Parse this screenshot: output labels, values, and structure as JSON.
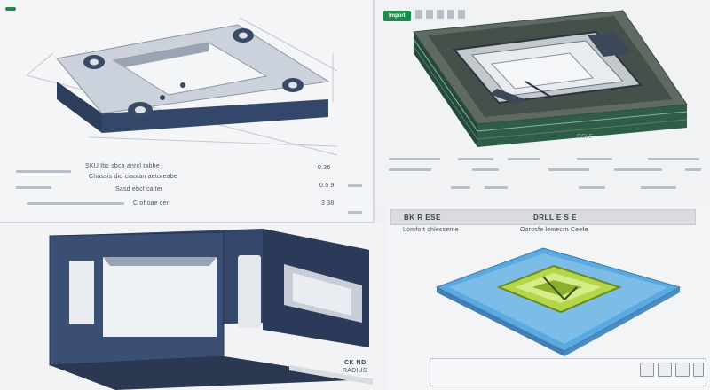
{
  "top_left": {
    "table": {
      "header": "SKU Ibc sbca anrcl tabhe",
      "rows": [
        "Chassis dio ciaotan aetoreabe",
        "Sasd ebct caiter",
        "C ohoae cer"
      ],
      "right_values": [
        "0.36",
        "0.5 9",
        "3 38"
      ]
    }
  },
  "top_right": {
    "toolbar_button": "Import"
  },
  "bottom_left": {
    "caption_line1": "CK ND",
    "caption_line2": "RADIUS"
  },
  "bottom_right": {
    "header_left": "BK R ESE",
    "header_right": "DRLL E S E",
    "sub_left": "Lomfort chlesseme",
    "sub_right": "Oarosfe lemecrn Ceefe"
  },
  "colors": {
    "accent_green": "#1f8a4c",
    "frame_navy": "#34466a",
    "plate_blue": "#5aa9e0",
    "pocket_lime": "#b4d64a"
  }
}
